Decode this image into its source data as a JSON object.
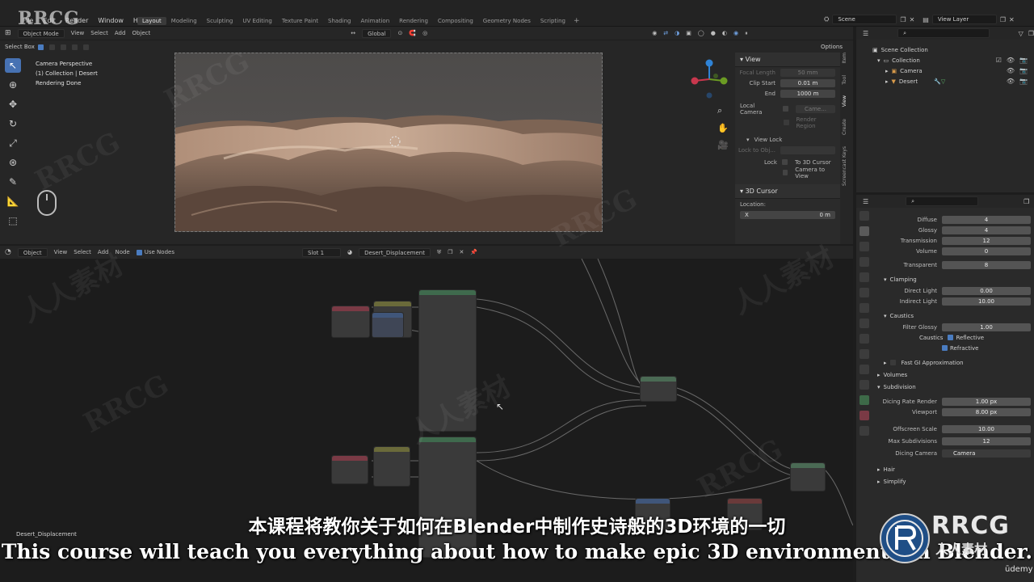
{
  "topbar": {
    "menus": [
      "File",
      "Edit",
      "Render",
      "Window",
      "Help"
    ],
    "workspaces": [
      "Layout",
      "Modeling",
      "Sculpting",
      "UV Editing",
      "Texture Paint",
      "Shading",
      "Animation",
      "Rendering",
      "Compositing",
      "Geometry Nodes",
      "Scripting"
    ],
    "active_workspace": "Layout",
    "scene": "Scene",
    "view_layer": "View Layer",
    "logo_text": "RRCG"
  },
  "viewport_header": {
    "mode": "Object Mode",
    "menus": [
      "View",
      "Select",
      "Add",
      "Object"
    ],
    "transform": "Global",
    "options": "Options",
    "select_box": "Select Box"
  },
  "viewport": {
    "overlay_lines": [
      "Camera Perspective",
      "(1) Collection | Desert",
      "Rendering Done"
    ]
  },
  "n_panel": {
    "title": "View",
    "focal_length_label": "Focal Length",
    "focal_length_value": "50 mm",
    "clip_start_label": "Clip Start",
    "clip_start_value": "0.01 m",
    "end_label": "End",
    "end_value": "1000 m",
    "local_camera_label": "Local Camera",
    "local_camera_value": "Came...",
    "render_region": "Render Region",
    "view_lock_title": "View Lock",
    "lock_to_obj_label": "Lock to Obj...",
    "lock_label": "Lock",
    "to_3d_cursor": "To 3D Cursor",
    "camera_to_view": "Camera to View",
    "cursor_title": "3D Cursor",
    "location_label": "Location:",
    "x_label": "X",
    "x_value": "0 m",
    "tabs": [
      "Item",
      "Tool",
      "View",
      "Create",
      "Screencast Keys"
    ]
  },
  "node_header": {
    "type": "Object",
    "menus": [
      "View",
      "Select",
      "Add",
      "Node"
    ],
    "use_nodes": "Use Nodes",
    "slot": "Slot 1",
    "material": "Desert_Displacement"
  },
  "node_editor": {
    "material_label": "Desert_Displacement"
  },
  "outliner": {
    "root": "Scene Collection",
    "collection": "Collection",
    "items": [
      "Camera",
      "Desert"
    ]
  },
  "properties": {
    "rows_top": [
      {
        "label": "Diffuse",
        "value": "4"
      },
      {
        "label": "Glossy",
        "value": "4"
      },
      {
        "label": "Transmission",
        "value": "12"
      },
      {
        "label": "Volume",
        "value": "0"
      },
      {
        "label": "Transparent",
        "value": "8"
      }
    ],
    "clamping_title": "Clamping",
    "direct_light_label": "Direct Light",
    "direct_light_value": "0.00",
    "indirect_light_label": "Indirect Light",
    "indirect_light_value": "10.00",
    "caustics_title": "Caustics",
    "filter_glossy_label": "Filter Glossy",
    "filter_glossy_value": "1.00",
    "caustics_label": "Caustics",
    "reflective": "Reflective",
    "refractive": "Refractive",
    "fast_gi": "Fast GI Approximation",
    "volumes": "Volumes",
    "subdivision": "Subdivision",
    "dicing_rate_label": "Dicing Rate Render",
    "dicing_rate_value": "1.00 px",
    "viewport_label": "Viewport",
    "viewport_value": "8.00 px",
    "offscreen_label": "Offscreen Scale",
    "offscreen_value": "10.00",
    "max_subdiv_label": "Max Subdivisions",
    "max_subdiv_value": "12",
    "dicing_camera_label": "Dicing Camera",
    "dicing_camera_value": "Camera",
    "hair": "Hair",
    "simplify": "Simplify"
  },
  "subtitles": {
    "cn": "本课程将教你关于如何在Blender中制作史诗般的3D环境的一切",
    "en": "This course will teach you everything about how to make epic 3D environments in Blender."
  },
  "branding": {
    "rrcg": "RRCG",
    "cn_brand": "人人素材",
    "udemy": "ūdemy"
  },
  "colors": {
    "accent": "#4772b3",
    "axis_x": "#c8374d",
    "axis_y": "#6b9b23",
    "axis_z": "#2f83d6"
  }
}
